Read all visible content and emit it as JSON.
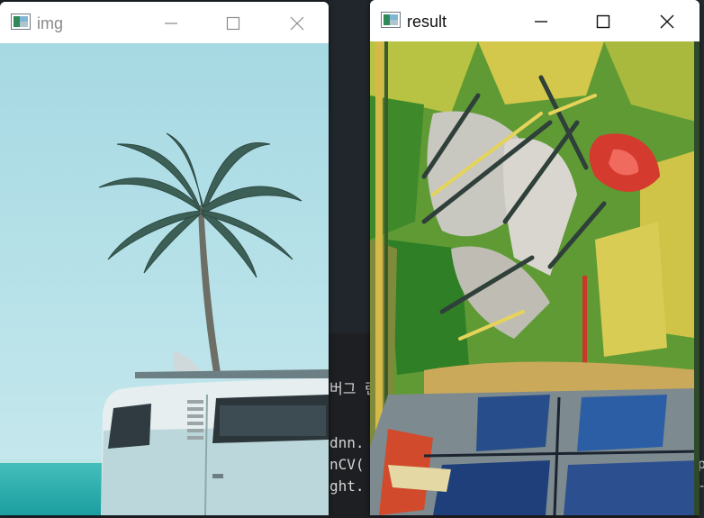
{
  "windows": {
    "img": {
      "title": "img"
    },
    "result": {
      "title": "result"
    }
  },
  "background_ide": {
    "lines": [
      "버그 란",
      "dnn.",
      "nCV(",
      "ght."
    ],
    "right_edge_chars": [
      "p",
      "-"
    ]
  },
  "icons": {
    "app": "opencv-window-icon",
    "minimize": "minimize-icon",
    "maximize": "maximize-icon",
    "close": "close-icon"
  },
  "colors": {
    "sky": "#a9dbe4",
    "sea": "#2fb4b2",
    "palm": "#3a5c54",
    "stylized_green": "#4f9a2f",
    "stylized_yellow": "#d8c84a",
    "stylized_red": "#d83a2e",
    "stylized_blue": "#2c5a9e"
  }
}
